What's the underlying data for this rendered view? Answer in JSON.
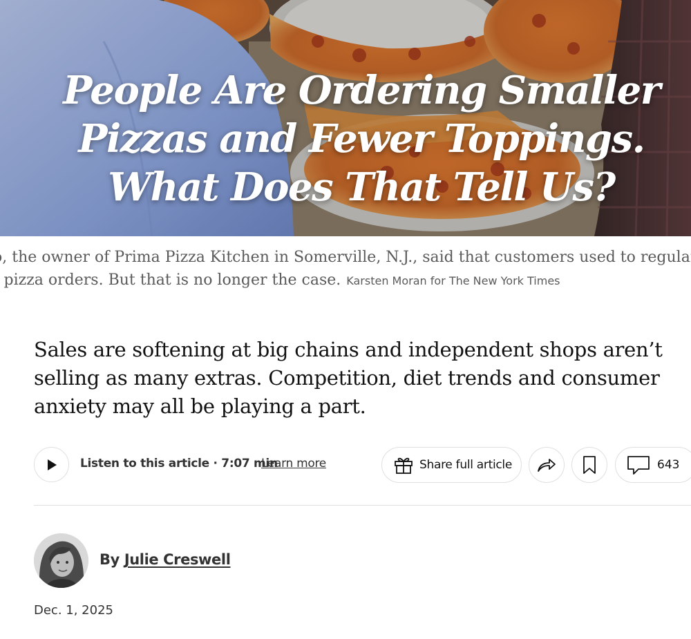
{
  "hero": {
    "headline_lines": [
      "People Are Ordering Smaller",
      "Pizzas and Fewer Toppings.",
      "What Does That Tell Us?"
    ]
  },
  "caption": {
    "line1": "o, the owner of Prima Pizza Kitchen in Somerville, N.J., said that customers used to regularly ad",
    "line2": "r pizza orders. But that is no longer the case.",
    "credit": "Karsten Moran for The New York Times"
  },
  "summary": "Sales are softening at big chains and independent shops aren’t selling as many extras. Competition, diet trends and consumer anxiety may all be playing a part.",
  "toolbar": {
    "listen_label": "Listen to this article · 7:07 min",
    "learn_more": "Learn more",
    "share_full_label": "Share full article",
    "comment_count": "643",
    "icons": [
      "play-icon",
      "gift-icon",
      "share-arrow-icon",
      "bookmark-icon",
      "comment-icon"
    ]
  },
  "byline": {
    "prefix": "By",
    "author": "Julie Creswell"
  },
  "date": "Dec. 1, 2025"
}
